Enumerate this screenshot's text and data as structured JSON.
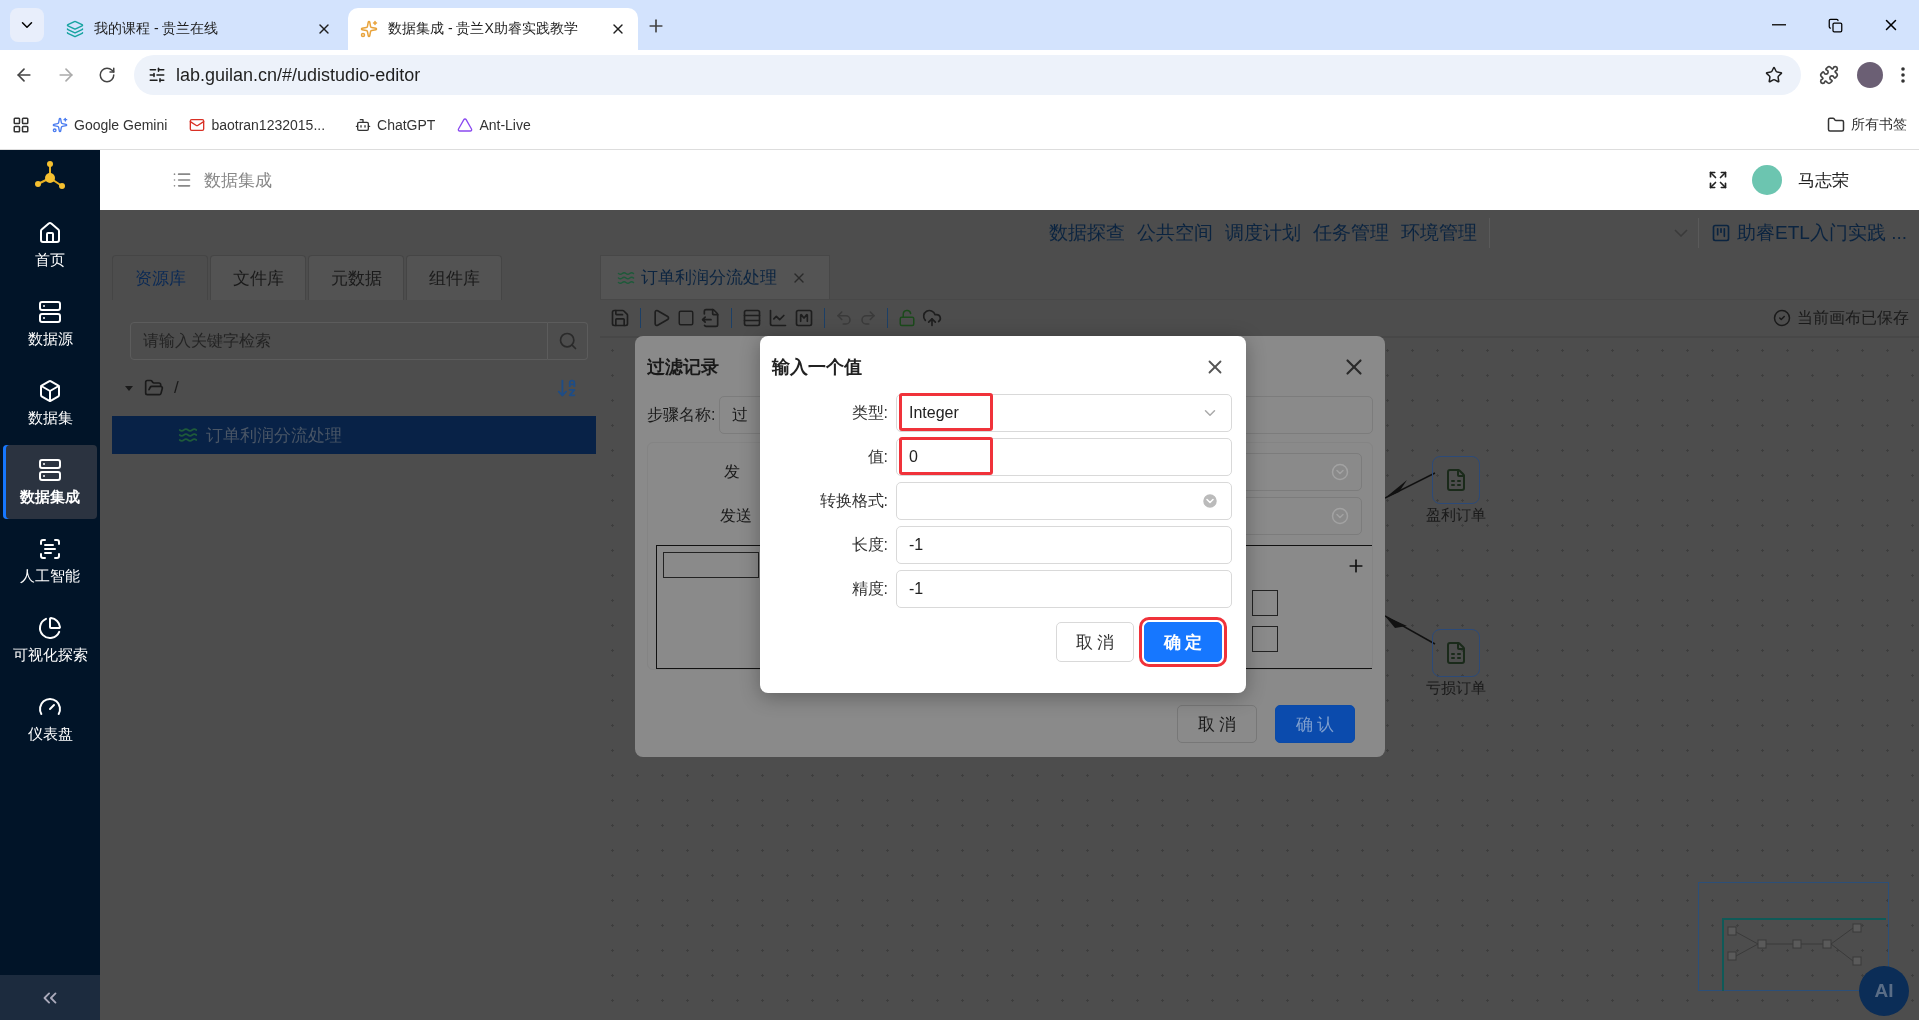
{
  "browser": {
    "tabs": [
      {
        "title": "我的课程 - 贵兰在线",
        "selected": false
      },
      {
        "title": "数据集成 - 贵兰X助睿实践教学",
        "selected": true
      }
    ],
    "url": "lab.guilan.cn/#/udistudio-editor",
    "bookmarks": [
      {
        "label": "Google Gemini"
      },
      {
        "label": "baotran1232015..."
      },
      {
        "label": "ChatGPT"
      },
      {
        "label": "Ant-Live"
      }
    ],
    "all_bookmarks": "所有书签"
  },
  "header": {
    "title": "数据集成",
    "user": "马志荣"
  },
  "sidebar": {
    "items": [
      {
        "label": "首页",
        "selected": false
      },
      {
        "label": "数据源",
        "selected": false
      },
      {
        "label": "数据集",
        "selected": false
      },
      {
        "label": "数据集成",
        "selected": true
      },
      {
        "label": "人工智能",
        "selected": false
      },
      {
        "label": "可视化探索",
        "selected": false
      },
      {
        "label": "仪表盘",
        "selected": false
      }
    ]
  },
  "top_nav": {
    "links": [
      "数据探查",
      "公共空间",
      "调度计划",
      "任务管理",
      "环境管理"
    ],
    "project": "助睿ETL入门实践 ..."
  },
  "left_panel": {
    "tabs": [
      {
        "label": "资源库",
        "selected": true
      },
      {
        "label": "文件库",
        "selected": false
      },
      {
        "label": "元数据",
        "selected": false
      },
      {
        "label": "组件库",
        "selected": false
      }
    ],
    "search": {
      "placeholder": "请输入关键字检索"
    },
    "tree": [
      {
        "label": "/",
        "expanded": true,
        "children": [
          {
            "label": "订单利润分流处理",
            "selected": true
          }
        ]
      }
    ]
  },
  "editor": {
    "tabs": [
      {
        "label": "订单利润分流处理",
        "selected": true
      }
    ],
    "status": "当前画布已保存",
    "nodes": [
      {
        "label": "盈利订单"
      },
      {
        "label": "亏损订单"
      }
    ],
    "ai_button": "AI"
  },
  "filter_dialog": {
    "title": "过滤记录",
    "step_label": "步骤名称:",
    "step_value": "过",
    "rows": [
      "发",
      "发送"
    ],
    "buttons": [
      "取 消",
      "确 认"
    ]
  },
  "value_dialog": {
    "title": "输入一个值",
    "fields": [
      {
        "label": "类型:",
        "kind": "select",
        "value": "Integer",
        "highlighted": true
      },
      {
        "label": "值:",
        "kind": "input",
        "value": "0",
        "highlighted": true
      },
      {
        "label": "转换格式:",
        "kind": "combo"
      },
      {
        "label": "长度:",
        "kind": "input",
        "value": "-1",
        "highlighted": false
      },
      {
        "label": "精度:",
        "kind": "input",
        "value": "-1",
        "highlighted": false
      }
    ],
    "buttons": [
      {
        "label": "取 消",
        "kind": "default",
        "highlighted": false
      },
      {
        "label": "确 定",
        "kind": "primary",
        "highlighted": true
      }
    ]
  }
}
